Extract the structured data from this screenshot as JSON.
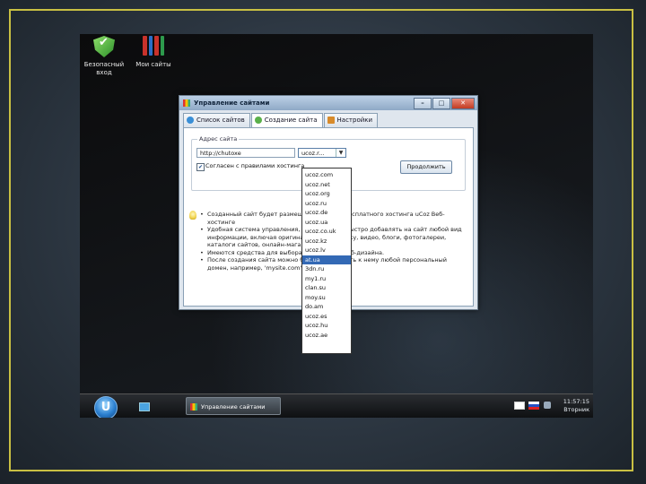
{
  "desktop": {
    "icons": [
      {
        "label": "Безопасный\nвход",
        "icon": "shield-icon"
      },
      {
        "label": "Мои сайты",
        "icon": "binders-icon"
      }
    ]
  },
  "window": {
    "title": "Управление сайтами",
    "controls": {
      "minimize": "–",
      "maximize": "□",
      "close": "✕"
    },
    "tabs": [
      {
        "label": "Список сайтов",
        "active": false
      },
      {
        "label": "Создание сайта",
        "active": true
      },
      {
        "label": "Настройки",
        "active": false
      }
    ],
    "address_group": {
      "title": "Адрес сайта",
      "url_value": "http://chutoxe",
      "domain_selected": "ucoz.r...",
      "agree_checked": true,
      "agree_label": "Согласен с правилами хостинга",
      "continue_label": "Продолжить"
    },
    "info_items": [
      "Созданный сайт будет размещен в системе бесплатного хостинга uCoz Веб-хостинге",
      "Удобная система управления, позволяющая быстро добавлять на сайт любой вид информации, включая оригинальные и графику, видео, блоги, фотогалереи, каталоги сайтов, онлайн-магазин и т.д.",
      "Имеются средства для выбора и настройки веб-дизайна.",
      "После создания сайта можно будет прикрепить к нему любой персональный домен, например, 'mysite.com'."
    ],
    "domain_options": [
      "ucoz.com",
      "ucoz.net",
      "ucoz.org",
      "ucoz.ru",
      "ucoz.de",
      "ucoz.ua",
      "ucoz.co.uk",
      "ucoz.kz",
      "ucoz.lv",
      "at.ua",
      "3dn.ru",
      "my1.ru",
      "clan.su",
      "moy.su",
      "do.am",
      "ucoz.es",
      "ucoz.hu",
      "ucoz.ae"
    ],
    "domain_highlighted": "at.ua"
  },
  "taskbar": {
    "start_label": "U",
    "task_label": "Управление сайтами",
    "clock_time": "11:57:15",
    "clock_day": "Вторник"
  }
}
